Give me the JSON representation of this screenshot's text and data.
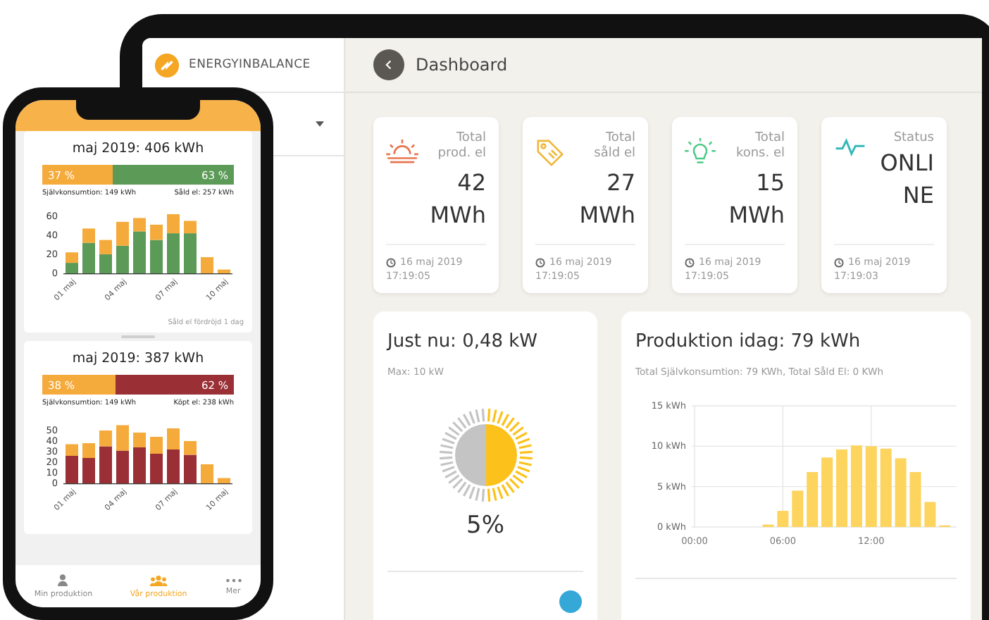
{
  "tablet": {
    "brand": "ENERGYINBALANCE",
    "title": "Dashboard",
    "stat_cards": [
      {
        "kind": "sun",
        "label": "Total prod. el",
        "value": "42 MWh",
        "date": "16 maj 2019",
        "time": "17:19:05"
      },
      {
        "kind": "tag",
        "label": "Total såld el",
        "value": "27 MWh",
        "date": "16 maj 2019",
        "time": "17:19:05"
      },
      {
        "kind": "bulb",
        "label": "Total kons. el",
        "value": "15 MWh",
        "date": "16 maj 2019",
        "time": "17:19:05"
      },
      {
        "kind": "pulse",
        "label": "Status",
        "value": "ONLINE",
        "date": "16 maj 2019",
        "time": "17:19:03"
      }
    ],
    "now": {
      "title": "Just nu: 0,48 kW",
      "subtitle": "Max: 10 kW",
      "percent": "5%"
    },
    "production": {
      "title": "Produktion idag: 79 kWh",
      "subtitle": "Total Självkonsumtion: 79 KWh, Total Såld El: 0 KWh",
      "chart_data": {
        "type": "bar",
        "grid": true,
        "x": [
          5,
          6,
          7,
          8,
          9,
          10,
          11,
          12,
          13,
          14,
          15,
          16,
          17
        ],
        "xlim": [
          0,
          17.8
        ],
        "ylim": [
          0,
          15
        ],
        "xticks": [
          {
            "value": 0,
            "label": "00:00"
          },
          {
            "value": 6,
            "label": "06:00"
          },
          {
            "value": 12,
            "label": "12:00"
          }
        ],
        "yticks": [
          {
            "value": 0,
            "label": "0 kWh"
          },
          {
            "value": 5,
            "label": "5 kWh"
          },
          {
            "value": 10,
            "label": "10 kWh"
          },
          {
            "value": 15,
            "label": "15 kWh"
          }
        ],
        "series": [
          {
            "color": "#fdd45e",
            "values": [
              0.3,
              2,
              4.5,
              6.8,
              8.6,
              9.6,
              10.1,
              10,
              9.7,
              8.5,
              6.8,
              3.1,
              0.2
            ]
          }
        ]
      }
    }
  },
  "phone": {
    "cards": [
      {
        "title": "maj 2019: 406 kWh",
        "split": {
          "level": 0.37,
          "left_label": "37 %",
          "right_label": "63 %",
          "color": "#5b9a57"
        },
        "left_note": "Självkonsumtion: 149 kWh",
        "right_note": "Såld el: 257 kWh",
        "chart_data": {
          "type": "bar",
          "stacked": true,
          "x": [
            1,
            2,
            3,
            4,
            5,
            6,
            7,
            8,
            9,
            10
          ],
          "xlim": [
            0.5,
            10.5
          ],
          "ylim": [
            0,
            62
          ],
          "yticks": [
            0,
            20,
            40,
            60
          ],
          "xticks": [
            {
              "value": 1,
              "label": "01 maj"
            },
            {
              "value": 4,
              "label": "04 maj"
            },
            {
              "value": 7,
              "label": "07 maj"
            },
            {
              "value": 10,
              "label": "10 maj"
            }
          ],
          "series": [
            {
              "color": "#5b9a57",
              "values": [
                11,
                32,
                20,
                29,
                44,
                35,
                42,
                42,
                0,
                0
              ]
            },
            {
              "color": "#f5ab3b",
              "values": [
                11,
                15,
                15,
                25,
                14,
                16,
                20,
                13,
                17,
                4
              ]
            }
          ]
        },
        "footnote": "Såld el fördröjd 1 dag"
      },
      {
        "title": "maj 2019: 387 kWh",
        "split": {
          "level": 0.38,
          "left_label": "38 %",
          "right_label": "62 %",
          "color": "#9a2f36"
        },
        "left_note": "Självkonsumtion: 149 kWh",
        "right_note": "Köpt el: 238 kWh",
        "chart_data": {
          "type": "bar",
          "stacked": true,
          "x": [
            1,
            2,
            3,
            4,
            5,
            6,
            7,
            8,
            9,
            10
          ],
          "xlim": [
            0.5,
            10.5
          ],
          "ylim": [
            0,
            56
          ],
          "yticks": [
            0,
            10,
            20,
            30,
            40,
            50
          ],
          "xticks": [
            {
              "value": 1,
              "label": "01 maj"
            },
            {
              "value": 4,
              "label": "04 maj"
            },
            {
              "value": 7,
              "label": "07 maj"
            },
            {
              "value": 10,
              "label": "10 maj"
            }
          ],
          "series": [
            {
              "color": "#9a2f36",
              "values": [
                26,
                24,
                35,
                31,
                34,
                28,
                32,
                27,
                0,
                0
              ]
            },
            {
              "color": "#f5ab3b",
              "values": [
                11,
                14,
                15,
                24,
                14,
                16,
                20,
                13,
                18,
                5
              ]
            }
          ]
        }
      }
    ],
    "tab_bar": [
      {
        "kind": "person",
        "label": "Min produktion",
        "selected": false
      },
      {
        "kind": "group",
        "label": "Vår produktion",
        "selected": true
      },
      {
        "kind": "dots",
        "label": "Mer",
        "selected": false
      }
    ]
  }
}
